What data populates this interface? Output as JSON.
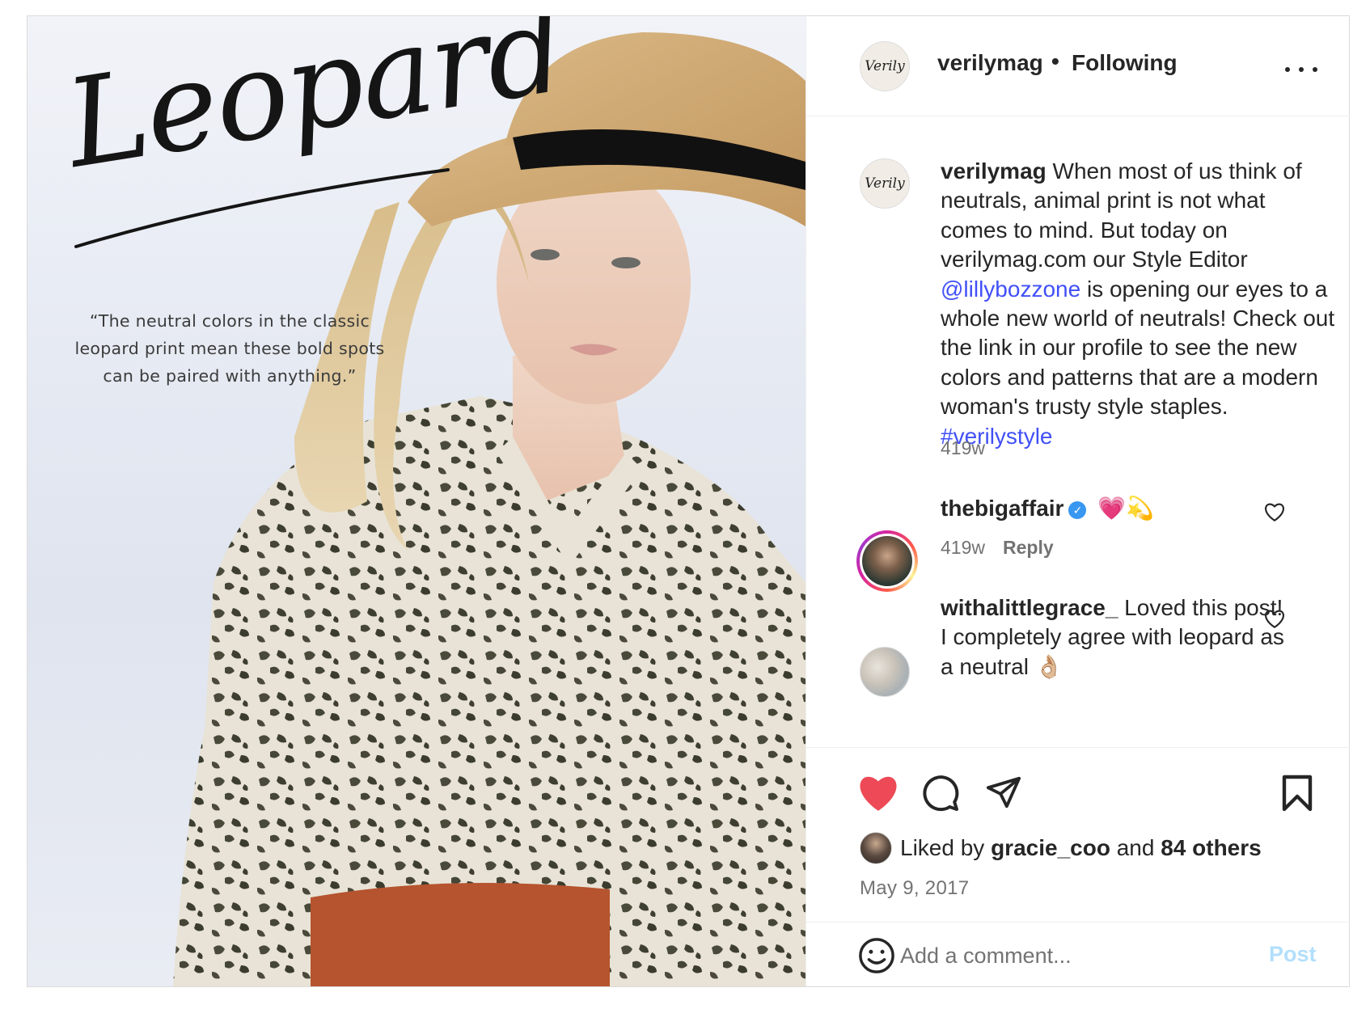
{
  "post_image": {
    "title_script": "Leopard",
    "quote": "“The neutral colors in the classic leopard print mean these bold spots can be paired with anything.”"
  },
  "header": {
    "username": "verilymag",
    "separator": "•",
    "follow_status": "Following",
    "avatar_text": "Verily"
  },
  "caption": {
    "username": "verilymag",
    "text_before_mention": " When most of us think of neutrals, animal print is not what comes to mind. But today on verilymag.com our Style Editor ",
    "mention": "@lillybozzone",
    "text_after_mention": " is opening our eyes to a whole new world of neutrals! Check out the link in our profile to see the new colors and patterns that are a modern woman's trusty style staples. ",
    "hashtag": "#verilystyle",
    "time": "419w"
  },
  "comments": [
    {
      "username": "thebigaffair",
      "verified": true,
      "text": "💗💫",
      "time": "419w",
      "reply_label": "Reply"
    },
    {
      "username": "withalittlegrace_",
      "text": " Loved this post! I completely agree with leopard as a neutral 👌🏼"
    }
  ],
  "actions": {
    "liked_by_prefix": "Liked by ",
    "liked_by_user": "gracie_coo",
    "liked_by_middle": " and ",
    "liked_by_count": "84 others",
    "date": "May 9, 2017"
  },
  "comment_box": {
    "placeholder": "Add a comment...",
    "post_label": "Post"
  },
  "colors": {
    "like_red": "#ed4956",
    "link_blue": "#4150f7",
    "verified_blue": "#3897f0",
    "post_disabled": "#b2dffc"
  }
}
